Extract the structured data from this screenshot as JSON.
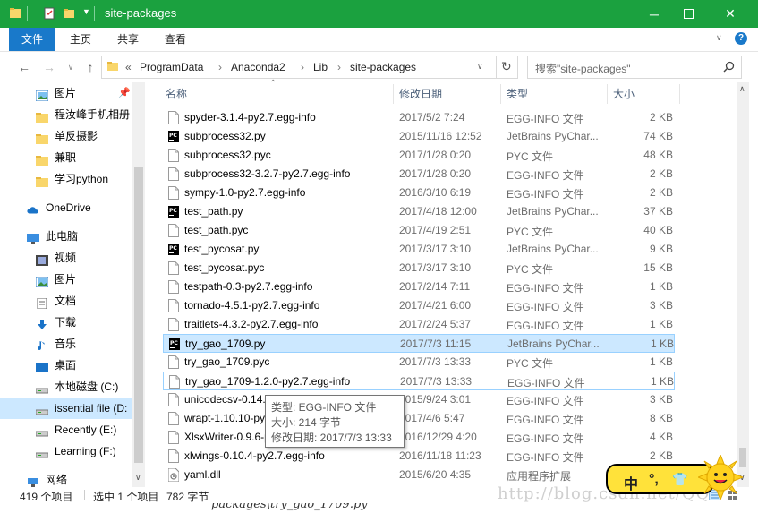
{
  "window": {
    "title": "site-packages"
  },
  "ribbon": {
    "tabs": [
      "文件",
      "主页",
      "共享",
      "查看"
    ]
  },
  "address": {
    "prefix": "«",
    "crumbs": [
      "ProgramData",
      "Anaconda2",
      "Lib",
      "site-packages"
    ],
    "separator": "›"
  },
  "search": {
    "placeholder": "搜索\"site-packages\""
  },
  "nav": {
    "items": [
      {
        "label": "图片",
        "icon": "pictures-icon",
        "pinned": true
      },
      {
        "label": "程汝峰手机相册",
        "icon": "folder-icon"
      },
      {
        "label": "单反摄影",
        "icon": "folder-icon"
      },
      {
        "label": "兼职",
        "icon": "folder-icon"
      },
      {
        "label": "学习python",
        "icon": "folder-icon"
      },
      {
        "label": "OneDrive",
        "icon": "cloud-icon"
      },
      {
        "label": "此电脑",
        "icon": "computer-icon"
      },
      {
        "label": "视频",
        "icon": "video-icon"
      },
      {
        "label": "图片",
        "icon": "pictures-icon"
      },
      {
        "label": "文档",
        "icon": "documents-icon"
      },
      {
        "label": "下载",
        "icon": "download-icon"
      },
      {
        "label": "音乐",
        "icon": "music-icon"
      },
      {
        "label": "桌面",
        "icon": "desktop-icon"
      },
      {
        "label": "本地磁盘 (C:)",
        "icon": "drive-icon"
      },
      {
        "label": "issential file (D:",
        "icon": "drive-icon",
        "selected": true
      },
      {
        "label": "Recently (E:)",
        "icon": "drive-icon"
      },
      {
        "label": "Learning (F:)",
        "icon": "drive-icon"
      },
      {
        "label": "网络",
        "icon": "network-icon"
      }
    ]
  },
  "columns": {
    "name": "名称",
    "date": "修改日期",
    "type": "类型",
    "size": "大小"
  },
  "files": [
    {
      "name": "spyder-3.1.4-py2.7.egg-info",
      "date": "2017/5/2 7:24",
      "type": "EGG-INFO 文件",
      "size": "2 KB",
      "icon": "file-icon"
    },
    {
      "name": "subprocess32.py",
      "date": "2015/11/16 12:52",
      "type": "JetBrains PyChar...",
      "size": "74 KB",
      "icon": "pycharm-icon"
    },
    {
      "name": "subprocess32.pyc",
      "date": "2017/1/28 0:20",
      "type": "PYC 文件",
      "size": "48 KB",
      "icon": "file-icon"
    },
    {
      "name": "subprocess32-3.2.7-py2.7.egg-info",
      "date": "2017/1/28 0:20",
      "type": "EGG-INFO 文件",
      "size": "2 KB",
      "icon": "file-icon"
    },
    {
      "name": "sympy-1.0-py2.7.egg-info",
      "date": "2016/3/10 6:19",
      "type": "EGG-INFO 文件",
      "size": "2 KB",
      "icon": "file-icon"
    },
    {
      "name": "test_path.py",
      "date": "2017/4/18 12:00",
      "type": "JetBrains PyChar...",
      "size": "37 KB",
      "icon": "pycharm-icon"
    },
    {
      "name": "test_path.pyc",
      "date": "2017/4/19 2:51",
      "type": "PYC 文件",
      "size": "40 KB",
      "icon": "file-icon"
    },
    {
      "name": "test_pycosat.py",
      "date": "2017/3/17 3:10",
      "type": "JetBrains PyChar...",
      "size": "9 KB",
      "icon": "pycharm-icon"
    },
    {
      "name": "test_pycosat.pyc",
      "date": "2017/3/17 3:10",
      "type": "PYC 文件",
      "size": "15 KB",
      "icon": "file-icon"
    },
    {
      "name": "testpath-0.3-py2.7.egg-info",
      "date": "2017/2/14 7:11",
      "type": "EGG-INFO 文件",
      "size": "1 KB",
      "icon": "file-icon"
    },
    {
      "name": "tornado-4.5.1-py2.7.egg-info",
      "date": "2017/4/21 6:00",
      "type": "EGG-INFO 文件",
      "size": "3 KB",
      "icon": "file-icon"
    },
    {
      "name": "traitlets-4.3.2-py2.7.egg-info",
      "date": "2017/2/24 5:37",
      "type": "EGG-INFO 文件",
      "size": "1 KB",
      "icon": "file-icon"
    },
    {
      "name": "try_gao_1709.py",
      "date": "2017/7/3 11:15",
      "type": "JetBrains PyChar...",
      "size": "1 KB",
      "icon": "pycharm-icon",
      "state": "hover"
    },
    {
      "name": "try_gao_1709.pyc",
      "date": "2017/7/3 13:33",
      "type": "PYC 文件",
      "size": "1 KB",
      "icon": "file-icon"
    },
    {
      "name": "try_gao_1709-1.2.0-py2.7.egg-info",
      "date": "2017/7/3 13:33",
      "type": "EGG-INFO 文件",
      "size": "1 KB",
      "icon": "file-icon",
      "state": "focus"
    },
    {
      "name": "unicodecsv-0.14.1-py2.7.egg-info",
      "date": "2015/9/24 3:01",
      "type": "EGG-INFO 文件",
      "size": "3 KB",
      "icon": "file-icon"
    },
    {
      "name": "wrapt-1.10.10-py2.7.egg-info",
      "date": "2017/4/6 5:47",
      "type": "EGG-INFO 文件",
      "size": "8 KB",
      "icon": "file-icon"
    },
    {
      "name": "XlsxWriter-0.9.6-py2.7.egg-info",
      "date": "2016/12/29 4:20",
      "type": "EGG-INFO 文件",
      "size": "4 KB",
      "icon": "file-icon"
    },
    {
      "name": "xlwings-0.10.4-py2.7.egg-info",
      "date": "2016/11/18 11:23",
      "type": "EGG-INFO 文件",
      "size": "2 KB",
      "icon": "file-icon"
    },
    {
      "name": "yaml.dll",
      "date": "2015/6/20 4:35",
      "type": "应用程序扩展",
      "size": "",
      "icon": "dll-icon"
    }
  ],
  "tooltip": {
    "type": "类型: EGG-INFO 文件",
    "size": "大小: 214 字节",
    "modified": "修改日期: 2017/7/3 13:33"
  },
  "status": {
    "count": "419 个项目",
    "selected": "选中 1 个项目",
    "selected_size": "782 字节"
  },
  "background": {
    "caption": "packages\\try_gao_1709.py"
  },
  "watermark": "http://blog.csdn.net/QQ",
  "ime": {
    "lang": "中",
    "punct": "°,",
    "shirt": "👕"
  },
  "colors": {
    "title_bar": "#1ba13f",
    "file_tab": "#1979ca",
    "selection": "#cce8ff",
    "selection_border": "#99d1ff"
  }
}
